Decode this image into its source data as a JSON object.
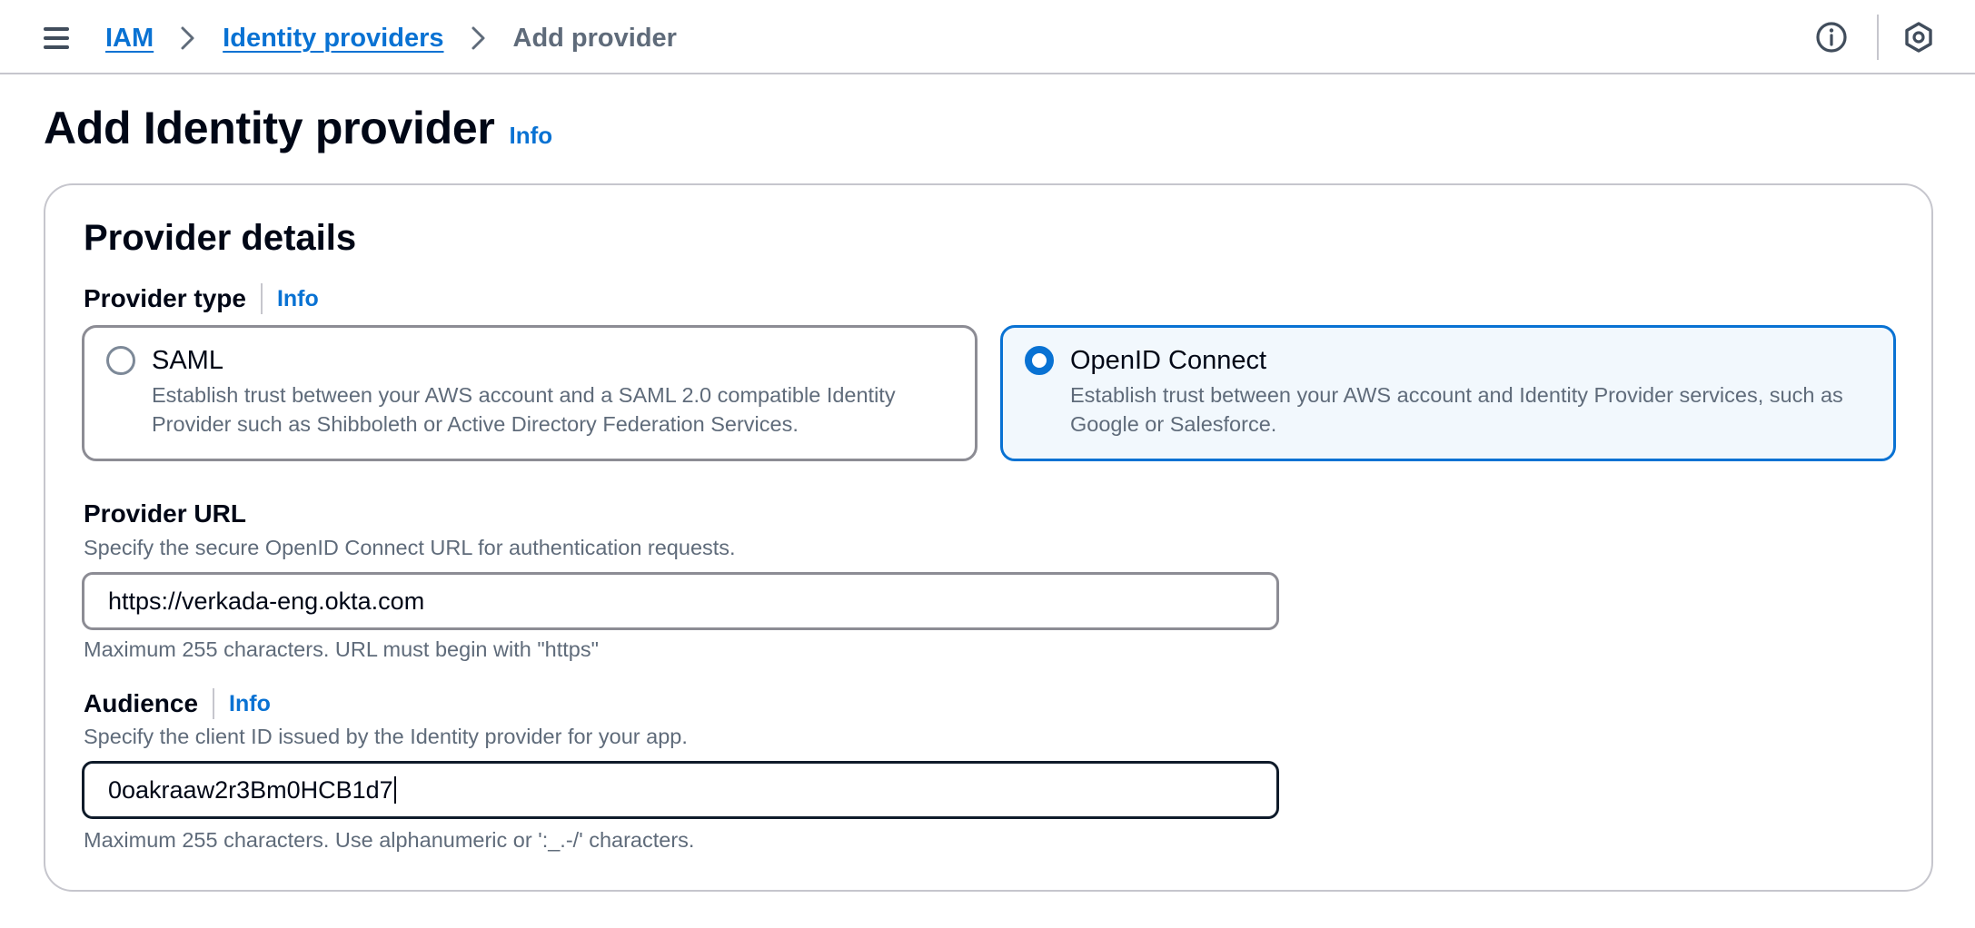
{
  "breadcrumb": {
    "items": [
      "IAM",
      "Identity providers"
    ],
    "current": "Add provider"
  },
  "page": {
    "title": "Add Identity provider",
    "info": "Info"
  },
  "provider_details": {
    "title": "Provider details",
    "provider_type": {
      "label": "Provider type",
      "info": "Info",
      "options": [
        {
          "title": "SAML",
          "description": "Establish trust between your AWS account and a SAML 2.0 compatible Identity Provider such as Shibboleth or Active Directory Federation Services.",
          "selected": false
        },
        {
          "title": "OpenID Connect",
          "description": "Establish trust between your AWS account and Identity Provider services, such as Google or Salesforce.",
          "selected": true
        }
      ]
    },
    "provider_url": {
      "label": "Provider URL",
      "description": "Specify the secure OpenID Connect URL for authentication requests.",
      "value": "https://verkada-eng.okta.com",
      "constraint": "Maximum 255 characters. URL must begin with \"https\""
    },
    "audience": {
      "label": "Audience",
      "info": "Info",
      "description": "Specify the client ID issued by the Identity provider for your app.",
      "value": "0oakraaw2r3Bm0HCB1d7",
      "constraint": "Maximum 255 characters. Use alphanumeric or ':_.-/' characters."
    }
  },
  "icons": {
    "menu": "hamburger-menu-icon",
    "breadcrumb_separator": "chevron-right-icon",
    "top_info": "info-circle-icon",
    "top_settings": "hexagon-settings-icon"
  },
  "colors": {
    "link": "#0972d3",
    "selected_border": "#0972d3",
    "selected_bg": "#f2f8fd",
    "focused_border": "#0f1b2a",
    "muted_text": "#5f6b7a"
  }
}
